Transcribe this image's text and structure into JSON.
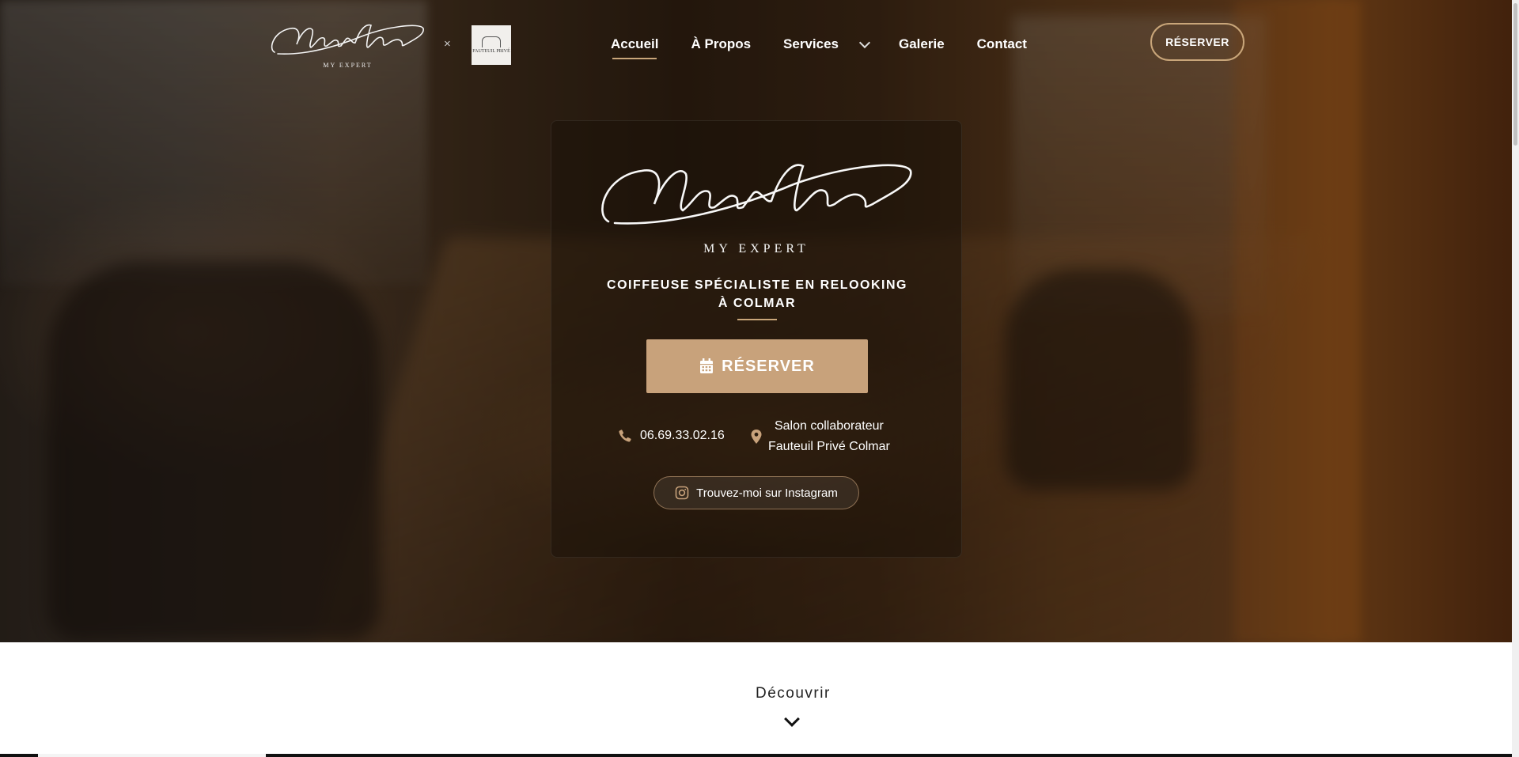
{
  "header": {
    "logo_subtitle": "MY EXPERT",
    "separator": "×",
    "partner_logo_text": "FAUTEUIL PRIVÉ",
    "nav": {
      "home": "Accueil",
      "about": "À Propos",
      "services": "Services",
      "gallery": "Galerie",
      "contact": "Contact"
    },
    "book_label": "RÉSERVER"
  },
  "hero": {
    "logo_subtitle": "MY EXPERT",
    "tagline_line1": "COIFFEUSE SPÉCIALISTE EN RELOOKING",
    "tagline_line2": "À COLMAR",
    "book_label": "RÉSERVER",
    "phone": "06.69.33.02.16",
    "location_line1": "Salon collaborateur",
    "location_line2": "Fauteuil Privé Colmar",
    "instagram_label": "Trouvez-moi sur Instagram"
  },
  "discover_label": "Découvrir",
  "colors": {
    "accent": "#c8a27b",
    "hero_dark": "#2b1d10",
    "text_light": "#ffffff"
  },
  "icons": {
    "phone": "phone-icon",
    "location": "map-marker-icon",
    "calendar": "calendar-icon",
    "instagram": "instagram-icon",
    "chevron": "chevron-down-icon"
  }
}
